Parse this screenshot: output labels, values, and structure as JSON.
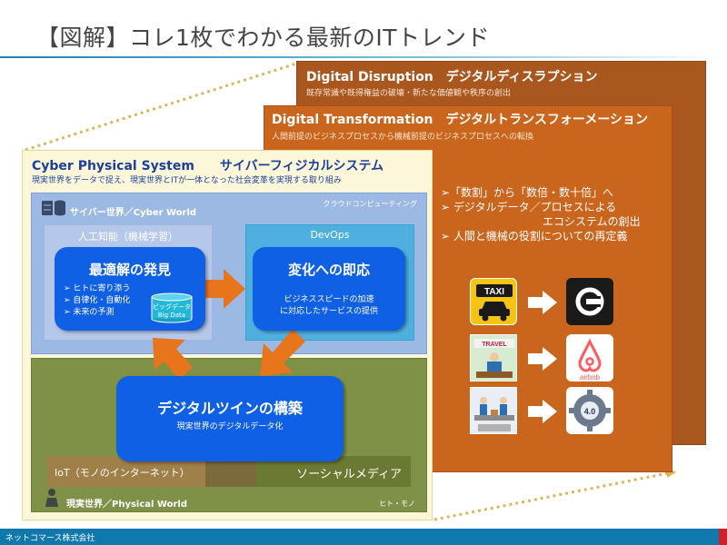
{
  "title": "【図解】コレ1枚でわかる最新のITトレンド",
  "disruption": {
    "heading": "Digital Disruption　デジタルディスラプション",
    "subtitle": "既存常識や既得権益の破壊・新たな価値観や秩序の創出"
  },
  "transformation": {
    "heading": "Digital Transformation　デジタルトランスフォーメーション",
    "subtitle": "人間前提のビジネスプロセスから機械前提のビジネスプロセスへの転換"
  },
  "trends": {
    "item1": "➢「数割」から「数倍・数十倍」へ",
    "item2": "➢ デジタルデータ／プロセスによる",
    "item2_cont": "エコシステムの創出",
    "item3": "➢ 人間と機械の役割についての再定義"
  },
  "examples": [
    {
      "from": "TAXI",
      "to": "Uber"
    },
    {
      "from": "TRAVEL",
      "to": "airbnb"
    },
    {
      "from": "factory",
      "to": "4.0"
    }
  ],
  "cps": {
    "heading": "Cyber Physical System　　サイバーフィジカルシステム",
    "subtitle": "現実世界をデータで捉え、現実世界とITが一体となった社会変革を実現する取り組み"
  },
  "cyber": {
    "label": "サイバー世界／Cyber World",
    "cloud": "クラウドコンピューティング",
    "ai_label": "人工知能（機械学習）",
    "devops_label": "DevOps"
  },
  "optimal": {
    "title": "最適解の発見",
    "bullets": [
      "➢ ヒトに寄り添う",
      "➢ 自律化・自動化",
      "➢ 未来の予測"
    ]
  },
  "bigdata": {
    "line1": "ビッグデータ",
    "line2": "Big Data"
  },
  "adapt": {
    "title": "変化への即応",
    "line1": "ビジネススピードの加速",
    "line2": "に対応したサービスの提供"
  },
  "twin": {
    "title": "デジタルツインの構築",
    "desc": "現実世界のデジタルデータ化"
  },
  "physical": {
    "label": "現実世界／Physical World",
    "hito": "ヒト・モノ",
    "iot": "IoT（モノのインターネット）",
    "social": "ソーシャルメディア"
  },
  "footer": "ネットコマース株式会社",
  "colors": {
    "disruption": "#a9571f",
    "transformation": "#c9651c",
    "cps_bg": "#fdf7d9",
    "cyber": "#9cb9e4",
    "card": "#1060e6",
    "arrow": "#e8751c",
    "physical": "#7f9147",
    "footer": "#0f78ad"
  }
}
